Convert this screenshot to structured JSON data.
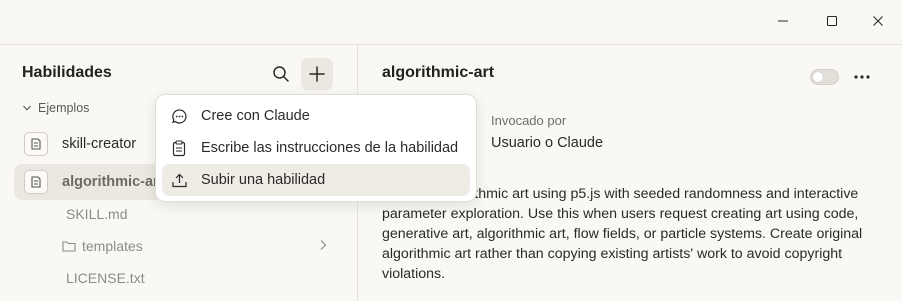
{
  "window": {
    "controls": [
      "minimize-icon",
      "maximize-icon",
      "close-icon"
    ]
  },
  "sidebar": {
    "title": "Habilidades",
    "section_label": "Ejemplos",
    "skills": [
      {
        "label": "skill-creator",
        "icon": "document-icon"
      },
      {
        "label": "algorithmic-art",
        "icon": "document-icon"
      }
    ],
    "files": [
      {
        "label": "SKILL.md"
      },
      {
        "label": "templates",
        "icon": "folder-icon"
      },
      {
        "label": "LICENSE.txt"
      }
    ]
  },
  "menu": {
    "items": [
      {
        "label": "Cree con Claude",
        "icon": "chat-icon"
      },
      {
        "label": "Escribe las instrucciones de la habilidad",
        "icon": "clipboard-icon"
      },
      {
        "label": "Subir una habilidad",
        "icon": "upload-icon"
      }
    ]
  },
  "detail": {
    "title": "algorithmic-art",
    "invoked_label": "Invocado por",
    "invoked_value": "Usuario o Claude",
    "description": "Creating algorithmic art using p5.js with seeded randomness and interactive parameter exploration. Use this when users request creating art using code, generative art, algorithmic art, flow fields, or particle systems. Create original algorithmic art rather than copying existing artists' work to avoid copyright violations."
  },
  "colors": {
    "background": "#f9f8f5",
    "selected_row": "#ebe8e1",
    "menu_hover": "#efece6",
    "divider": "#e6e3dc"
  }
}
